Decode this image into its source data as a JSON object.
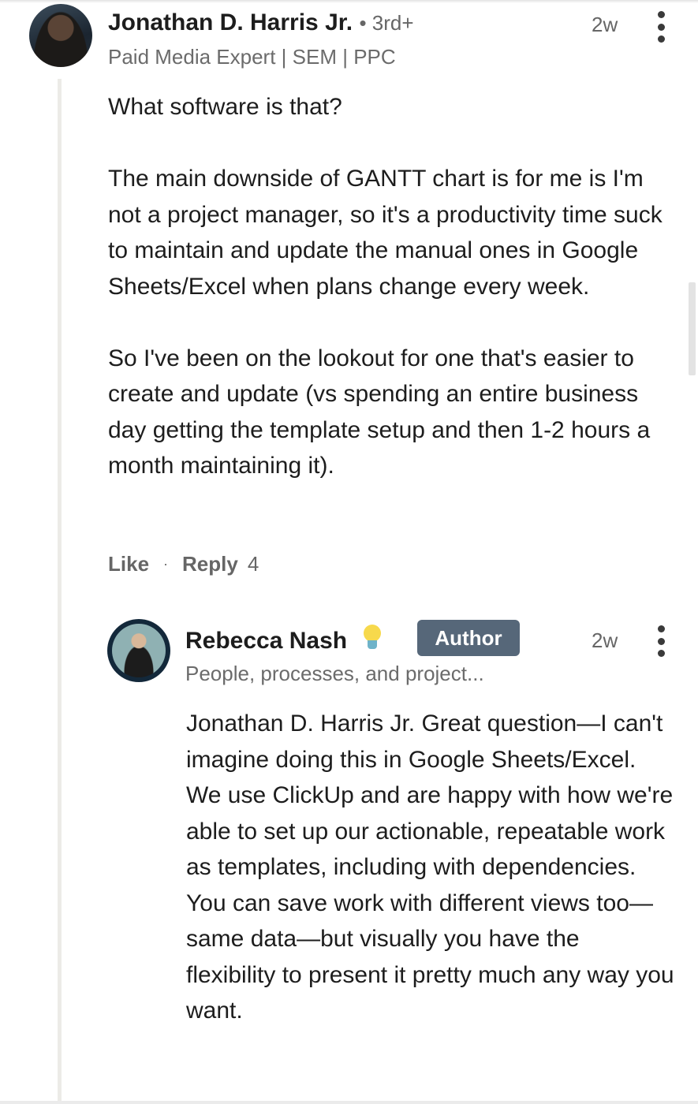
{
  "comment": {
    "author": "Jonathan D. Harris Jr.",
    "connection_degree": "• 3rd+",
    "headline": "Paid Media Expert | SEM | PPC",
    "time": "2w",
    "paragraphs": [
      "What software is that?",
      "The main downside of GANTT chart is for me is I'm not a project manager, so it's a productivity time suck to maintain and update the manual ones in Google Sheets/Excel when plans change every week.",
      "So I've been on the lookout for one that's easier to create and update (vs spending an entire business day getting the template setup and then 1-2 hours a month maintaining it)."
    ],
    "actions": {
      "like_label": "Like",
      "separator": "·",
      "reply_label": "Reply",
      "reply_count": "4"
    }
  },
  "reply": {
    "author": "Rebecca Nash",
    "badge_label": "Author",
    "headline": "People, processes, and project...",
    "time": "2w",
    "text": "Jonathan D. Harris Jr. Great question—I can't imagine doing this in Google Sheets/Excel. We use ClickUp and are happy with how we're able to set up our actionable, repeatable work as templates, including with dependencies. You can save work with different views too—same data—but visually you have the flexibility to present it pretty much any way you want."
  },
  "colors": {
    "badge_bg": "#566779",
    "thread_line": "#ecebe7",
    "text_primary": "#1d1d1d",
    "text_secondary": "#666666"
  },
  "icons": {
    "comment_menu": "more-vertical-icon",
    "reply_menu": "more-vertical-icon",
    "creator_badge": "lightbulb-icon"
  }
}
